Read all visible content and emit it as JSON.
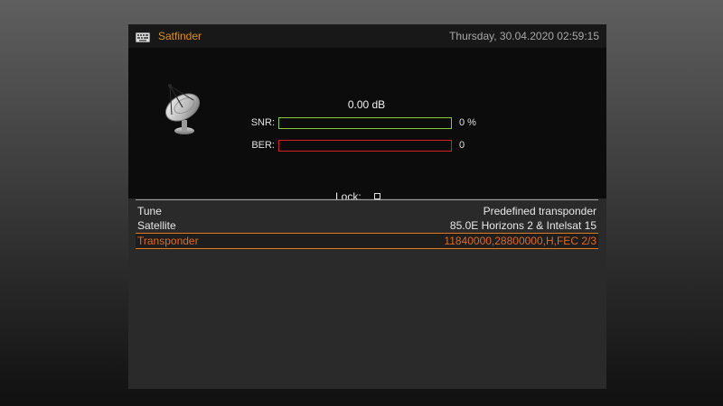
{
  "header": {
    "title": "Satfinder",
    "datetime": "Thursday, 30.04.2020  02:59:15",
    "icon": "keyboard-icon"
  },
  "signal": {
    "db_value": "0.00 dB",
    "snr_label": "SNR:",
    "snr_value": "0 %",
    "snr_fraction": 0,
    "snr_color": "#8cc83c",
    "ber_label": "BER:",
    "ber_value": "0",
    "ber_fraction": 0,
    "ber_color": "#d22020",
    "lock_label": "Lock:",
    "locked": false,
    "image": "satellite-dish-icon"
  },
  "settings": [
    {
      "label": "Tune",
      "value": "Predefined transponder",
      "selected": false
    },
    {
      "label": "Satellite",
      "value": "85.0E Horizons 2 & Intelsat 15",
      "selected": false
    },
    {
      "label": "Transponder",
      "value": "11840000,28800000,H,FEC 2/3",
      "selected": true
    }
  ],
  "colors": {
    "accent": "#e09018",
    "selection": "#e06a1c"
  }
}
